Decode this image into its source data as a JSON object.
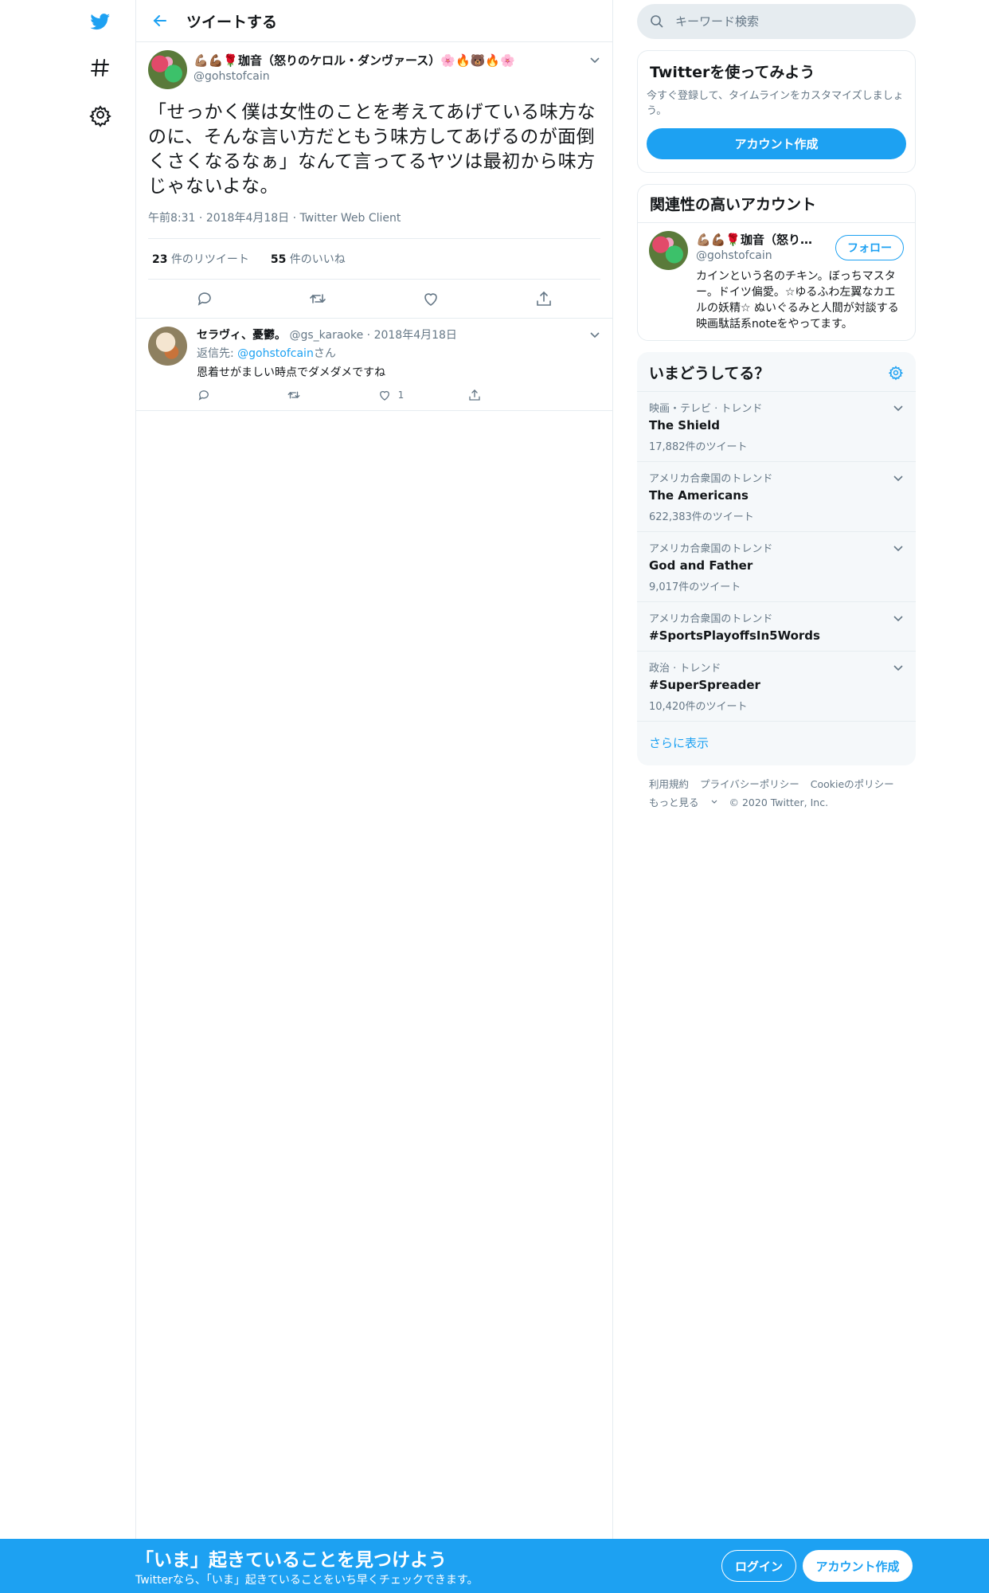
{
  "header": {
    "title": "ツイートする"
  },
  "tweet": {
    "display_name": "💪🏽💪🏾🌹珈音（怒りのケロル・ダンヴァース）🌸🔥🐻🔥🌸",
    "handle": "@gohstofcain",
    "text": "「せっかく僕は女性のことを考えてあげている味方なのに、そんな言い方だともう味方してあげるのが面倒くさくなるなぁ」なんて言ってるヤツは最初から味方じゃないよな。",
    "time": "午前8:31",
    "date": "2018年4月18日",
    "client": "Twitter Web Client",
    "retweets_count": "23",
    "retweets_label": "件のリツイート",
    "likes_count": "55",
    "likes_label": "件のいいね"
  },
  "reply": {
    "display_name": "セラヴィ、憂鬱。",
    "handle": "@gs_karaoke",
    "date": "2018年4月18日",
    "reply_to_label": "返信先:",
    "reply_to_handle": "@gohstofcain",
    "reply_to_suffix": "さん",
    "text": "恩着せがましい時点でダメダメですね",
    "like_count": "1"
  },
  "search": {
    "placeholder": "キーワード検索"
  },
  "signup_card": {
    "title": "Twitterを使ってみよう",
    "subtitle": "今すぐ登録して、タイムラインをカスタマイズしましょう。",
    "button": "アカウント作成"
  },
  "related": {
    "title": "関連性の高いアカウント",
    "name": "💪🏽💪🏾🌹珈音（怒りのケロル・ダンヴァース）",
    "handle": "@gohstofcain",
    "follow": "フォロー",
    "bio": "カインという名のチキン。ぼっちマスター。ドイツ偏愛。☆ゆるふわ左翼なカエルの妖精☆ ぬいぐるみと人間が対談する映画駄話系noteをやってます。"
  },
  "trends": {
    "title": "いまどうしてる？",
    "items": [
      {
        "context": "映画・テレビ · トレンド",
        "name": "The Shield",
        "count": "17,882件のツイート"
      },
      {
        "context": "アメリカ合衆国のトレンド",
        "name": "The Americans",
        "count": "622,383件のツイート"
      },
      {
        "context": "アメリカ合衆国のトレンド",
        "name": "God and Father",
        "count": "9,017件のツイート"
      },
      {
        "context": "アメリカ合衆国のトレンド",
        "name": "#SportsPlayoffsIn5Words",
        "count": ""
      },
      {
        "context": "政治 · トレンド",
        "name": "#SuperSpreader",
        "count": "10,420件のツイート"
      }
    ],
    "more": "さらに表示"
  },
  "footer": {
    "terms": "利用規約",
    "privacy": "プライバシーポリシー",
    "cookie": "Cookieのポリシー",
    "more": "もっと見る",
    "copyright": "© 2020 Twitter, Inc."
  },
  "bottom_bar": {
    "title": "「いま」起きていることを見つけよう",
    "subtitle": "Twitterなら、「いま」起きていることをいち早くチェックできます。",
    "login": "ログイン",
    "signup": "アカウント作成"
  },
  "colors": {
    "brand": "#1da1f2",
    "muted": "#657786",
    "border": "#e6ecf0"
  }
}
